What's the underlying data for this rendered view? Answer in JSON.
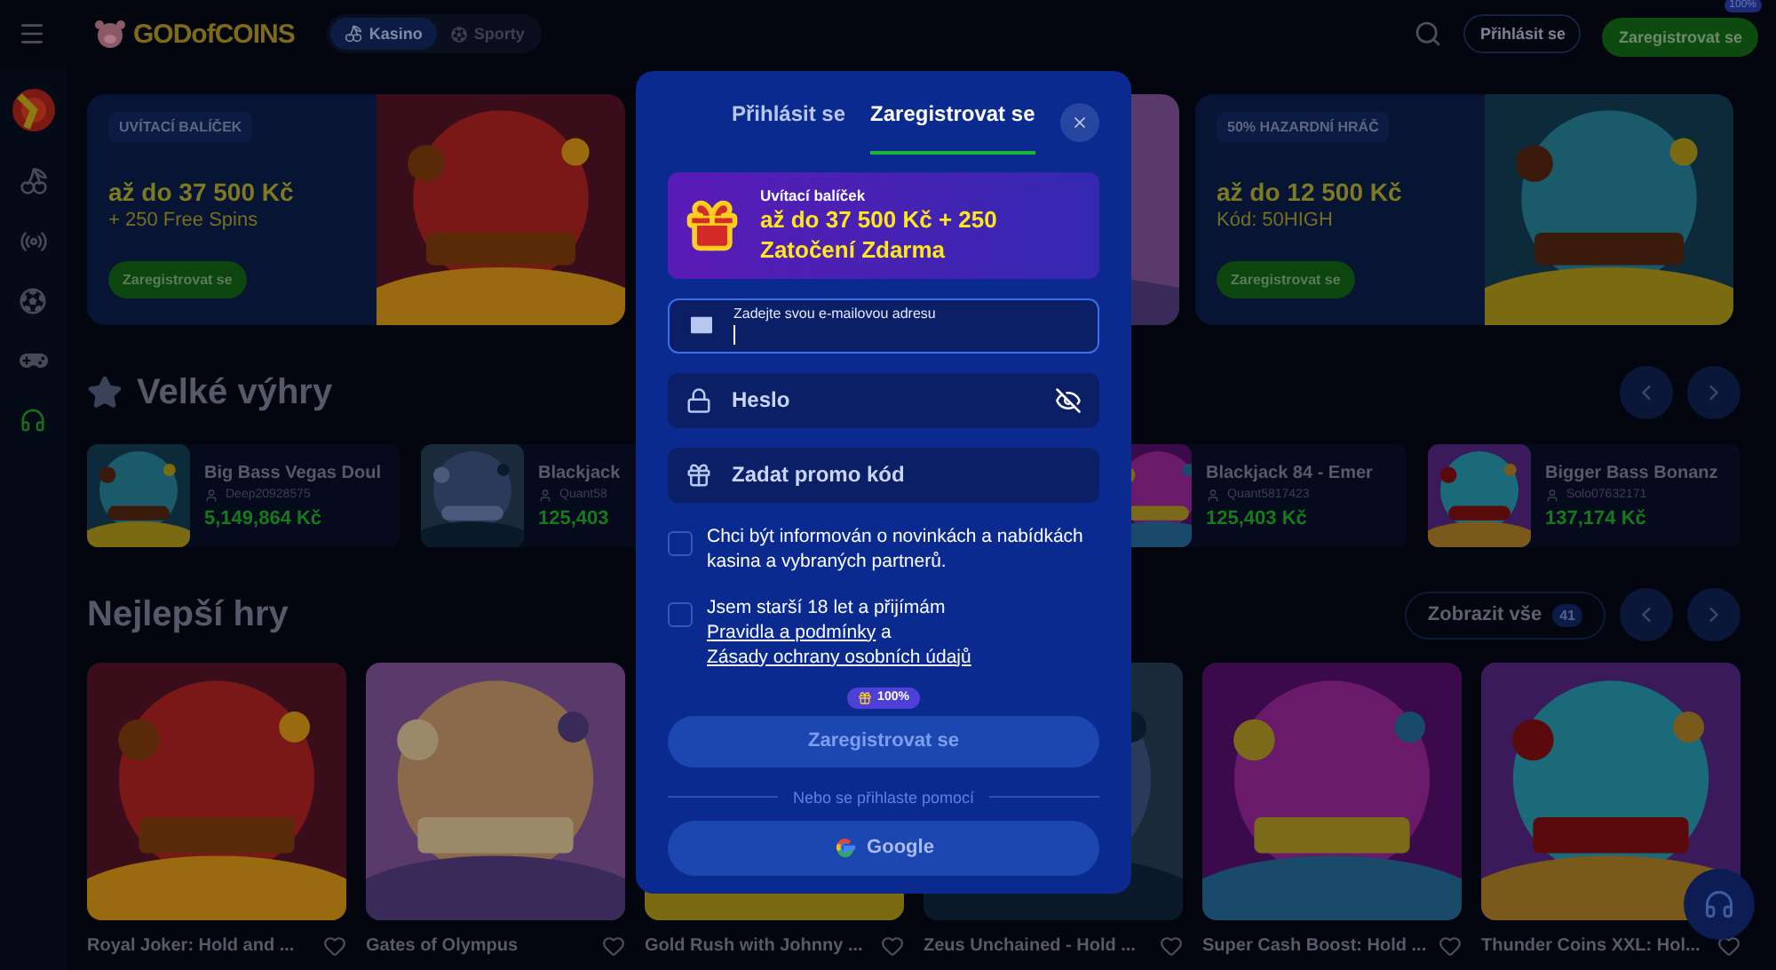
{
  "header": {
    "logo": "GODofCOINS",
    "tabs": [
      {
        "label": "Kasino",
        "selected": true
      },
      {
        "label": "Sporty",
        "selected": false
      }
    ],
    "login": "Přihlásit se",
    "register": "Zaregistrovat se",
    "register_badge": "100%"
  },
  "banners": [
    {
      "kind": "promo",
      "tag": "UVÍTACÍ BALÍČEK",
      "title": "až do 37 500 Kč",
      "subtitle": "+ 250 Free Spins",
      "button": "Zaregistrovat se"
    },
    {
      "kind": "picture"
    },
    {
      "kind": "promo",
      "tag": "50% HAZARDNÍ HRÁČ",
      "title": "až do 12 500 Kč",
      "subtitle": "Kód: 50HIGH",
      "button": "Zaregistrovat se"
    }
  ],
  "big_wins": {
    "title": "Velké výhry",
    "items": [
      {
        "game": "Big Bass Vegas Doul",
        "player": "Deep20928575",
        "amount": "5,149,864 Kč"
      },
      {
        "game": "Blackjack",
        "player": "Quant58",
        "amount": "125,403"
      },
      {
        "game": "Blackjack 84 - Emer",
        "player": "Quant5817423",
        "amount": "125,403 Kč"
      },
      {
        "game": "Bigger Bass Bonanz",
        "player": "Solo07632171",
        "amount": "137,174 Kč"
      }
    ]
  },
  "best_games": {
    "title": "Nejlepší hry",
    "show_all": "Zobrazit vše",
    "count": "41",
    "games": [
      {
        "title": "Royal Joker: Hold and ..."
      },
      {
        "title": "Gates of Olympus"
      },
      {
        "title": "Gold Rush with Johnny ..."
      },
      {
        "title": "Zeus Unchained - Hold ..."
      },
      {
        "title": "Super Cash Boost: Hold ..."
      },
      {
        "title": "Thunder Coins XXL: Hol..."
      }
    ]
  },
  "modal": {
    "tabs": [
      {
        "label": "Přihlásit se",
        "selected": false
      },
      {
        "label": "Zaregistrovat se",
        "selected": true
      }
    ],
    "promo": {
      "caption": "Uvítací balíček",
      "text": "až do 37 500 Kč + 250 Zatočení Zdarma"
    },
    "email": {
      "label": "Zadejte svou e-mailovou adresu",
      "focused": true
    },
    "password": {
      "placeholder": "Heslo"
    },
    "promo_code": {
      "placeholder": "Zadat promo kód"
    },
    "consents": [
      {
        "text": "Chci být informován o novinkách a nabídkách kasina a vybraných partnerů.",
        "checked": false
      },
      {
        "text": "Jsem starší 18 let a přijímám",
        "links": [
          "Pravidla a podmínky",
          "Zásady ochrany osobních údajů"
        ],
        "joiner": "a",
        "checked": false
      }
    ],
    "badge": "100%",
    "submit": "Zaregistrovat se",
    "divider": "Nebo se přihlaste pomocí",
    "google": "Google"
  }
}
